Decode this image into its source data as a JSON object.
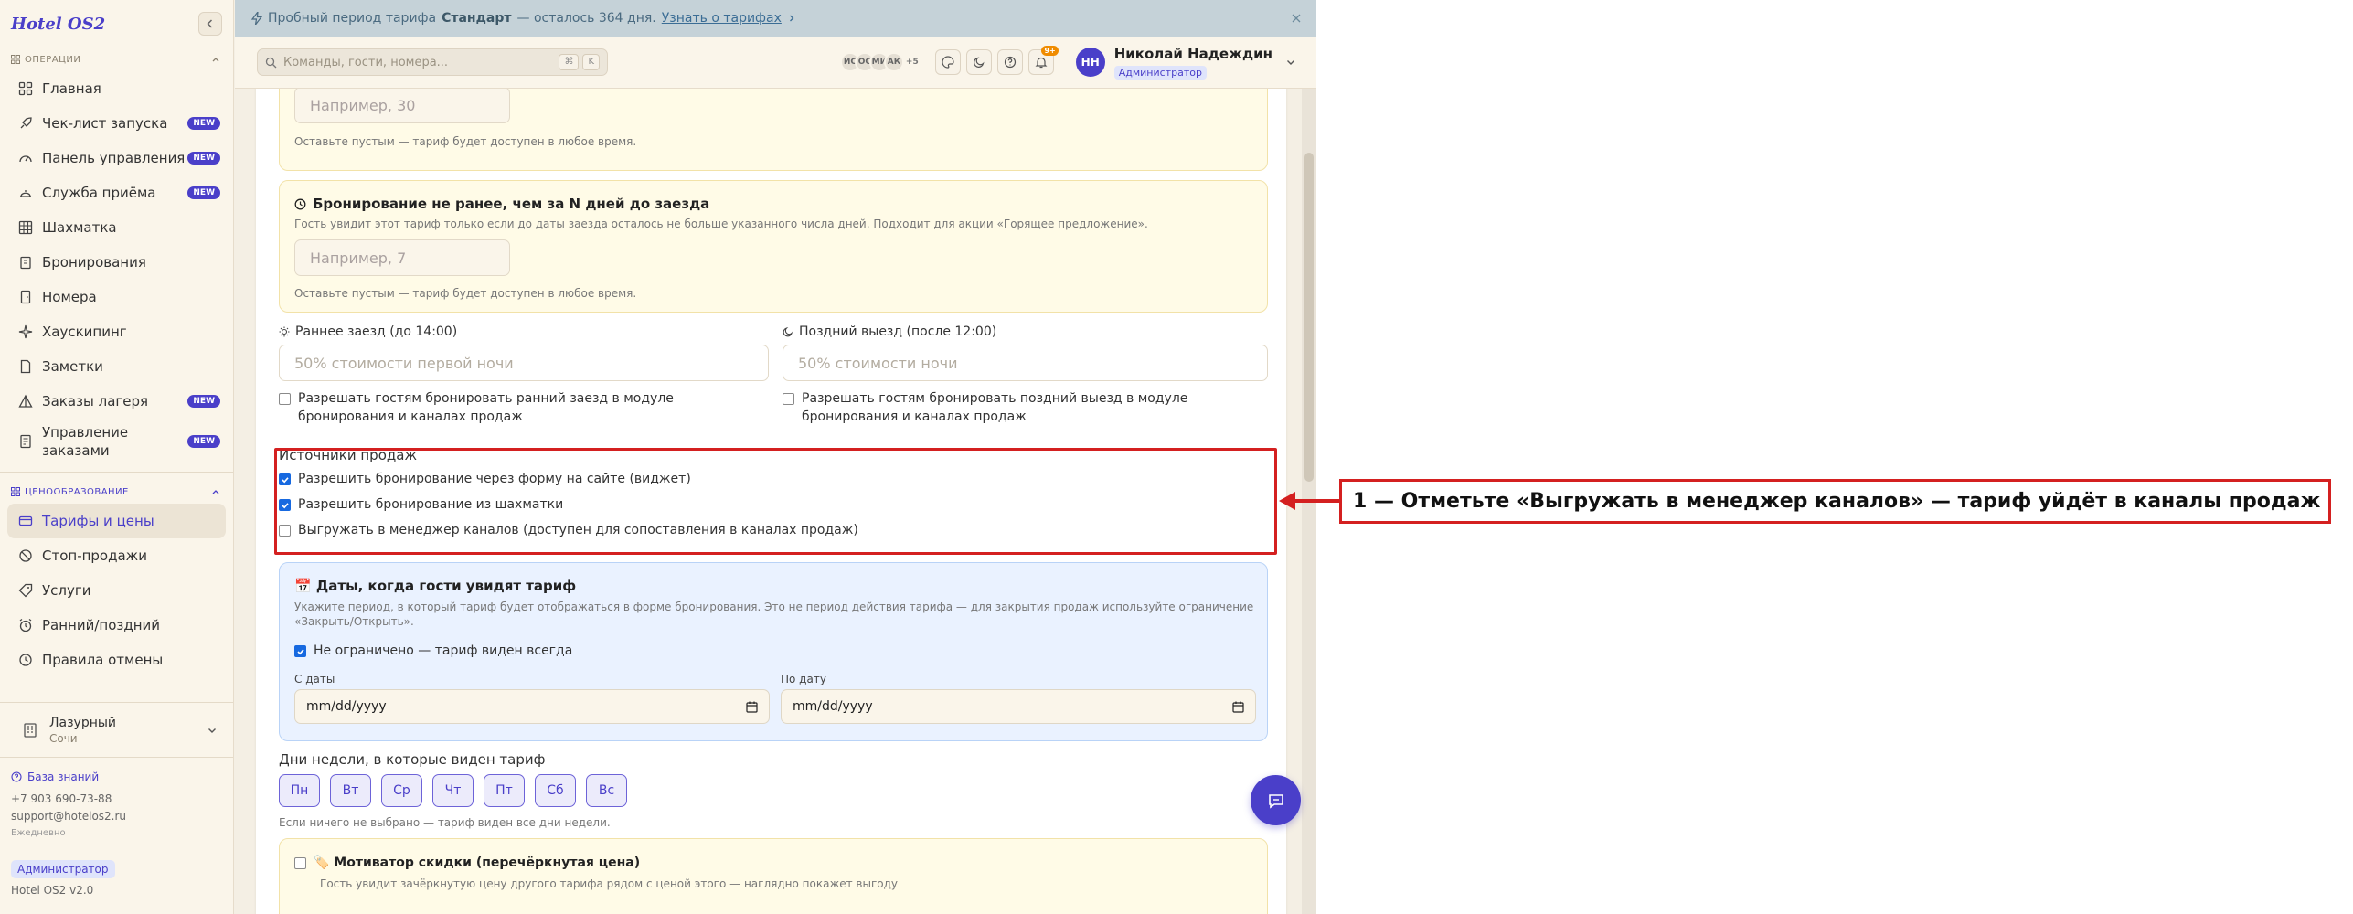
{
  "sidebar": {
    "logo": "Hotel OS2",
    "section_ops": "ОПЕРАЦИИ",
    "section_pricing": "ЦЕНООБРАЗОВАНИЕ",
    "ops_items": [
      {
        "label": "Главная",
        "new": false
      },
      {
        "label": "Чек-лист запуска",
        "new": true
      },
      {
        "label": "Панель управления",
        "new": true
      },
      {
        "label": "Служба приёма",
        "new": true
      },
      {
        "label": "Шахматка",
        "new": false
      },
      {
        "label": "Бронирования",
        "new": false
      },
      {
        "label": "Номера",
        "new": false
      },
      {
        "label": "Хаускипинг",
        "new": false
      },
      {
        "label": "Заметки",
        "new": false
      },
      {
        "label": "Заказы лагеря",
        "new": true
      },
      {
        "label": "Управление заказами",
        "new": true
      }
    ],
    "pricing_items": [
      {
        "label": "Тарифы и цены",
        "active": true
      },
      {
        "label": "Стоп-продажи",
        "active": false
      },
      {
        "label": "Услуги",
        "active": false
      },
      {
        "label": "Ранний/поздний",
        "active": false
      },
      {
        "label": "Правила отмены",
        "active": false
      }
    ],
    "new_badge": "NEW",
    "hotel": {
      "name": "Лазурный",
      "city": "Сочи"
    },
    "footer": {
      "kb_link": "База знаний",
      "phone": "+7 903 690-73-88",
      "email": "support@hotelos2.ru",
      "hours": "Ежедневно",
      "role": "Администратор",
      "version": "Hotel OS2 v2.0"
    }
  },
  "banner": {
    "prefix": "Пробный период тарифа",
    "plan": "Стандарт",
    "suffix": "— осталось 364 дня.",
    "link": "Узнать о тарифах"
  },
  "header": {
    "search_placeholder": "Команды, гости, номера...",
    "kbd1": "⌘",
    "kbd2": "K",
    "avatars": [
      "ИС",
      "ОС",
      "МИ",
      "АК"
    ],
    "avatars_more": "+5",
    "bell_count": "9+",
    "user_initials": "НН",
    "user_name": "Николай Надеждин",
    "user_role": "Администратор"
  },
  "form": {
    "box1": {
      "placeholder": "Например, 30",
      "hint": "Оставьте пустым — тариф будет доступен в любое время."
    },
    "box2": {
      "title": "Бронирование не ранее, чем за N дней до заезда",
      "desc": "Гость увидит этот тариф только если до даты заезда осталось не больше указанного числа дней. Подходит для акции «Горящее предложение».",
      "placeholder": "Например, 7",
      "hint": "Оставьте пустым — тариф будет доступен в любое время."
    },
    "early": {
      "label": "Раннее заезд (до 14:00)",
      "placeholder": "50% стоимости первой ночи",
      "checkbox": "Разрешать гостям бронировать ранний заезд в модуле бронирования и каналах продаж"
    },
    "late": {
      "label": "Поздний выезд (после 12:00)",
      "placeholder": "50% стоимости ночи",
      "checkbox": "Разрешать гостям бронировать поздний выезд в модуле бронирования и каналах продаж"
    },
    "sources": {
      "title": "Источники продаж",
      "items": [
        {
          "label": "Разрешить бронирование через форму на сайте (виджет)",
          "checked": true
        },
        {
          "label": "Разрешить бронирование из шахматки",
          "checked": true
        },
        {
          "label": "Выгружать в менеджер каналов (доступен для сопоставления в каналах продаж)",
          "checked": false
        }
      ]
    },
    "dates": {
      "title": "📅 Даты, когда гости увидят тариф",
      "desc": "Укажите период, в который тариф будет отображаться в форме бронирования. Это не период действия тарифа — для закрытия продаж используйте ограничение «Закрыть/Открыть».",
      "unlimited": "Не ограничено — тариф виден всегда",
      "unlimited_checked": true,
      "from_label": "С даты",
      "to_label": "По дату",
      "from_value": "mm/dd/yyyy",
      "to_value": "mm/dd/yyyy"
    },
    "weekdays": {
      "title": "Дни недели, в которые виден тариф",
      "days": [
        "Пн",
        "Вт",
        "Ср",
        "Чт",
        "Пт",
        "Сб",
        "Вс"
      ],
      "hint": "Если ничего не выбрано — тариф виден все дни недели."
    },
    "motivator": {
      "title": "🏷️ Мотиватор скидки (перечёркнутая цена)",
      "desc": "Гость увидит зачёркнутую цену другого тарифа рядом с ценой этого — наглядно покажет выгоду"
    }
  },
  "annotation": {
    "text": "1 — Отметьте «Выгружать в менеджер каналов» — тариф уйдёт в каналы продаж"
  },
  "colors": {
    "accent": "#4a3fc9",
    "highlight": "#d42020"
  }
}
